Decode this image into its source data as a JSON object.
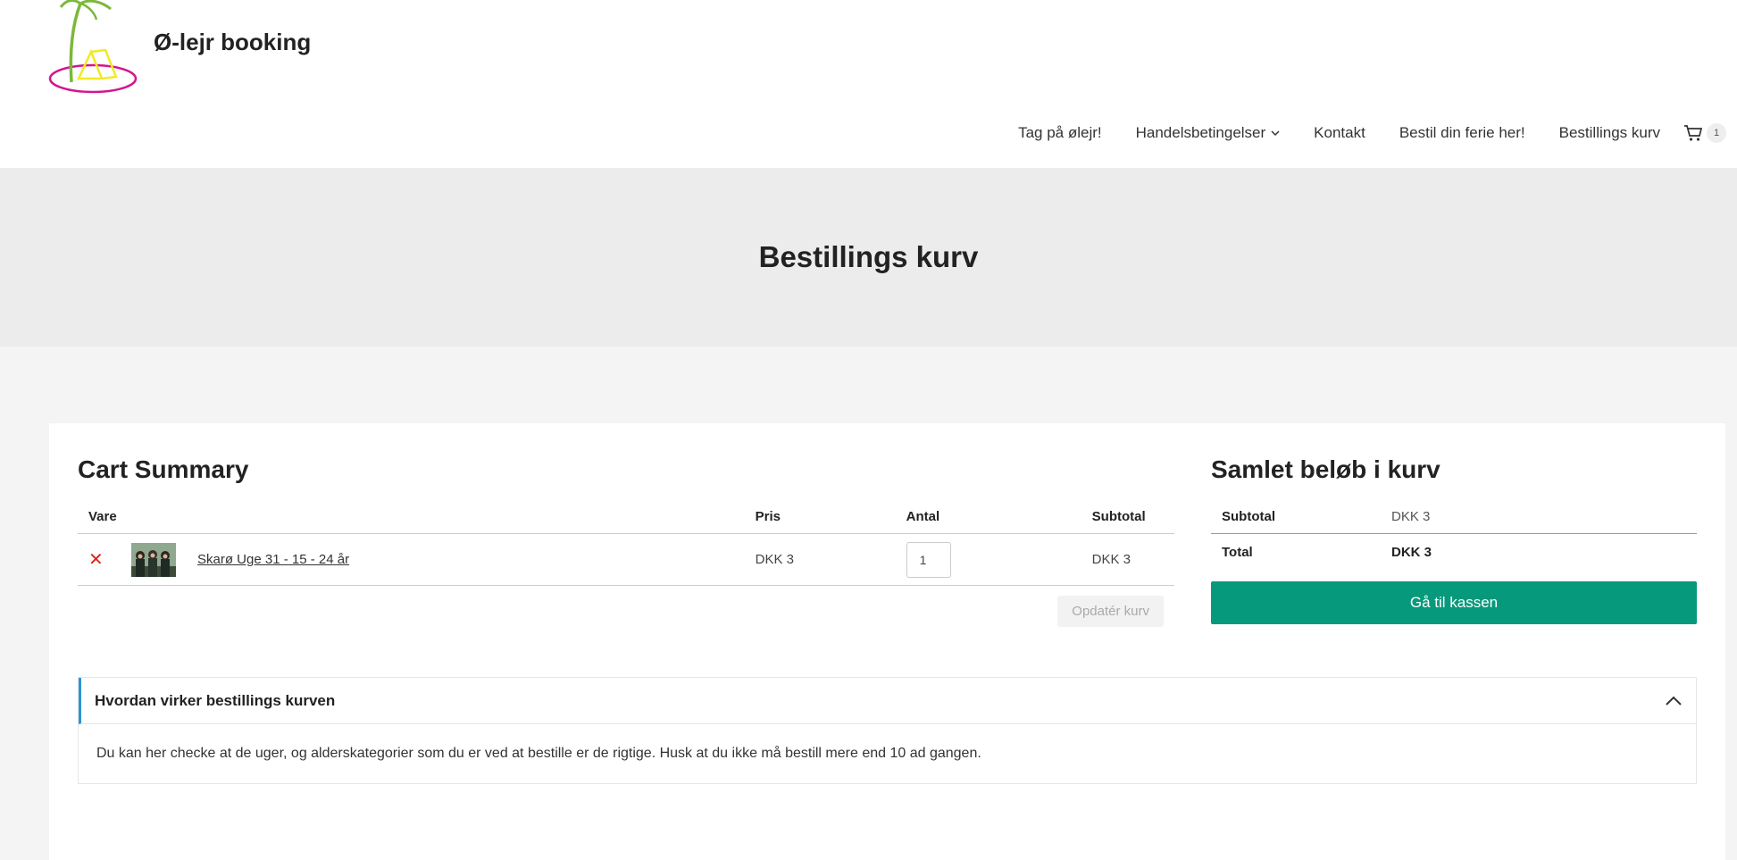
{
  "site": {
    "title": "Ø-lejr booking"
  },
  "nav": {
    "items": [
      "Tag på ølejr!",
      "Handelsbetingelser",
      "Kontakt",
      "Bestil din ferie her!",
      "Bestillings kurv"
    ],
    "cart_count": "1"
  },
  "hero": {
    "title": "Bestillings kurv"
  },
  "cart": {
    "title": "Cart Summary",
    "headers": {
      "product": "Vare",
      "price": "Pris",
      "quantity": "Antal",
      "subtotal": "Subtotal"
    },
    "items": [
      {
        "name": "Skarø Uge 31 - 15 - 24 år",
        "price": "DKK 3",
        "quantity": "1",
        "subtotal": "DKK 3"
      }
    ],
    "update_label": "Opdatér kurv"
  },
  "totals": {
    "title": "Samlet beløb i kurv",
    "subtotal_label": "Subtotal",
    "subtotal_value": "DKK 3",
    "total_label": "Total",
    "total_value": "DKK 3",
    "checkout_label": "Gå til kassen"
  },
  "info": {
    "title": "Hvordan virker bestillings kurven",
    "body": "Du kan her checke at de uger, og alderskategorier som du er ved at bestille er de rigtige. Husk at du ikke må bestill mere end 10 ad gangen."
  },
  "colors": {
    "checkout": "#07997b",
    "remove": "#e2241b",
    "accordion_accent": "#2d95d3"
  },
  "icons": [
    "palm-island-logo",
    "chevron-down-icon",
    "cart-icon",
    "remove-icon",
    "chevron-up-icon"
  ]
}
